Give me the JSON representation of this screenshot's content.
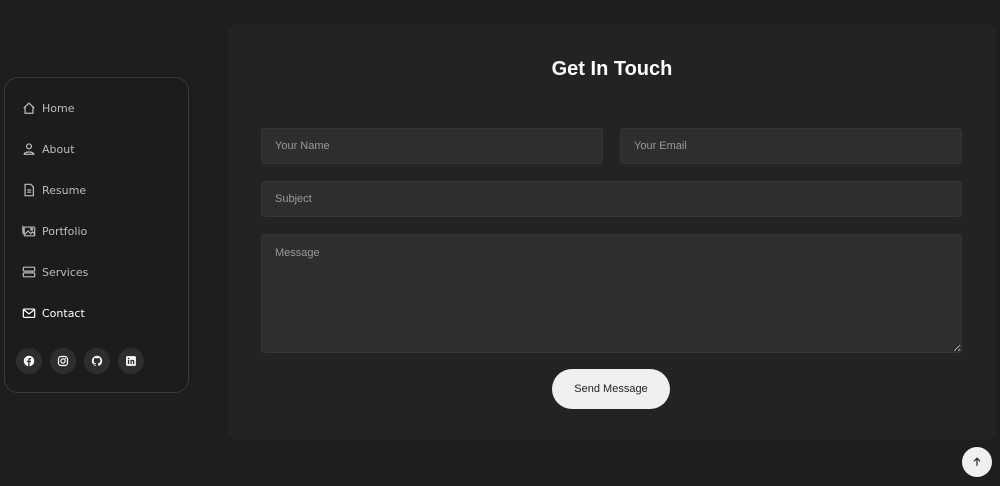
{
  "sidebar": {
    "items": [
      {
        "label": "Home",
        "icon": "home-icon"
      },
      {
        "label": "About",
        "icon": "user-icon"
      },
      {
        "label": "Resume",
        "icon": "file-icon"
      },
      {
        "label": "Portfolio",
        "icon": "image-icon"
      },
      {
        "label": "Services",
        "icon": "server-icon"
      },
      {
        "label": "Contact",
        "icon": "envelope-icon",
        "active": true
      }
    ],
    "socials": [
      "facebook-icon",
      "instagram-icon",
      "github-icon",
      "linkedin-icon"
    ]
  },
  "contact": {
    "title": "Get In Touch",
    "name_placeholder": "Your Name",
    "email_placeholder": "Your Email",
    "subject_placeholder": "Subject",
    "message_placeholder": "Message",
    "send_label": "Send Message"
  },
  "colors": {
    "background": "#1e1e1e",
    "card": "#232323",
    "field": "#2e2e2e",
    "button": "#f2f0ef"
  }
}
